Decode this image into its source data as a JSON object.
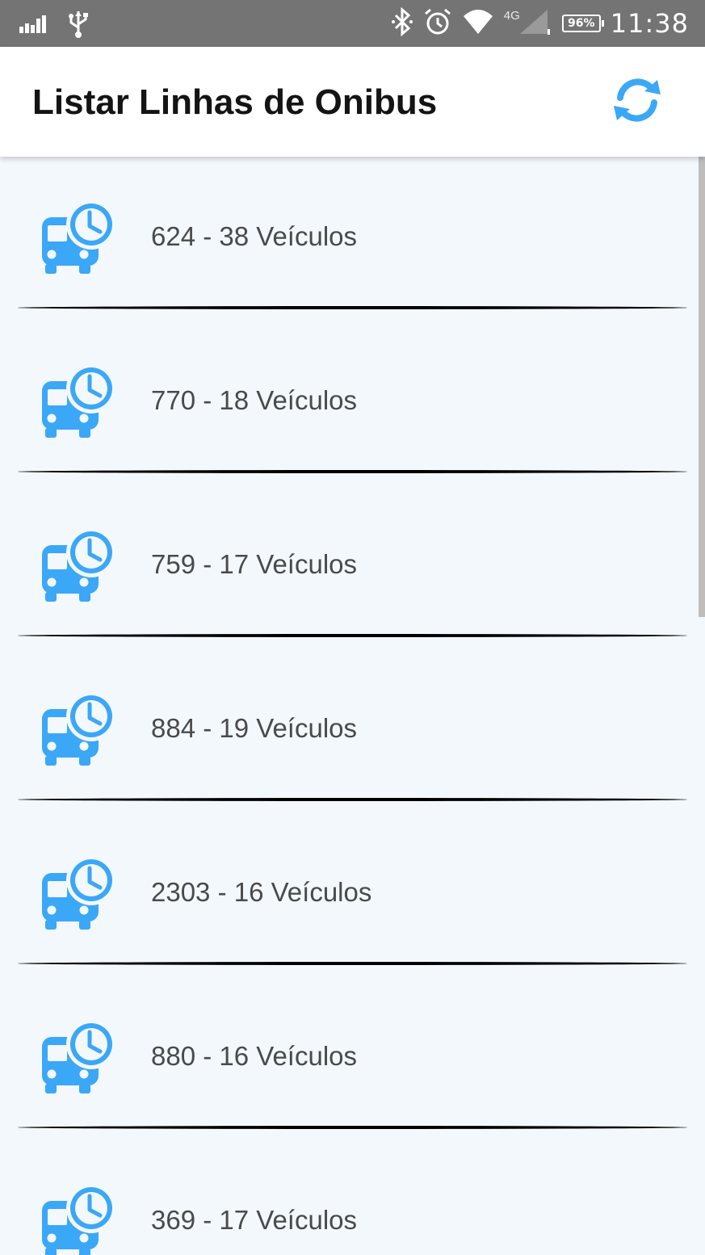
{
  "status_bar": {
    "battery": "96%",
    "network": "4G",
    "time": "11:38",
    "icons": [
      "signal-bars-icon",
      "usb-icon",
      "bluetooth-icon",
      "alarm-icon",
      "wifi-icon",
      "cell-signal-icon",
      "battery-icon"
    ]
  },
  "app_bar": {
    "title": "Listar Linhas de Onibus",
    "refresh_icon": "refresh-icon"
  },
  "accent_color": "#3ba7f7",
  "bus_lines": [
    {
      "label": "624 - 38 Veículos"
    },
    {
      "label": "770 - 18 Veículos"
    },
    {
      "label": "759 - 17 Veículos"
    },
    {
      "label": "884 - 19 Veículos"
    },
    {
      "label": "2303 - 16 Veículos"
    },
    {
      "label": "880 - 16 Veículos"
    },
    {
      "label": "369 - 17 Veículos"
    }
  ]
}
